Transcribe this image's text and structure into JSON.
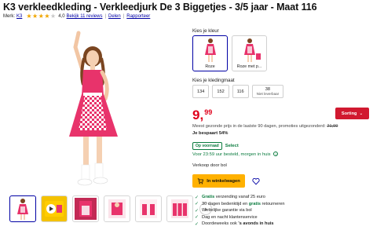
{
  "product": {
    "title": "K3 verkleedkleding - Verkleedjurk De 3 Biggetjes - 3/5 jaar - Maat 116",
    "brand_prefix": "Merk:",
    "brand": "K3",
    "rating": 4.0,
    "rating_text": "4,0",
    "reviews_link": "Bekijk 11 reviews",
    "share": "Delen",
    "report": "Rapporteer"
  },
  "thumbnails": [
    "thumb-dress-front",
    "thumb-video",
    "thumb-detail",
    "thumb-pack-1",
    "thumb-pack-2",
    "thumb-pack-3"
  ],
  "color_selector": {
    "label": "Kies je kleur",
    "options": [
      {
        "label": "Roze",
        "selected": true
      },
      {
        "label": "Roze met p...",
        "selected": false
      }
    ]
  },
  "size_selector": {
    "label": "Kies je kledingmaat",
    "options": [
      {
        "label": "134",
        "sub": ""
      },
      {
        "label": "152",
        "sub": ""
      },
      {
        "label": "116",
        "sub": ""
      },
      {
        "label": "38",
        "sub": "Niet leverbaar"
      }
    ]
  },
  "pricing": {
    "price_whole": "9,",
    "price_cents": "99",
    "sort_button": "Sorting",
    "prev_price_text": "Meest gezonde prijs in de laatste 90 dagen, promoties uitgezonderd:",
    "prev_price": "21,99",
    "savings": "Je bespaart 54%"
  },
  "availability": {
    "stock_badge": "Op voorraad",
    "select": "Select",
    "delivery": "Voor 23:59 uur besteld, morgen in huis",
    "seller": "Verkoop door bol"
  },
  "actions": {
    "cart_button": "In winkelwagen"
  },
  "usps": [
    {
      "pre": "",
      "highlight": "Gratis",
      "post": " verzending vanaf 25 euro"
    },
    {
      "pre": "30 dagen bedenktijd en ",
      "highlight": "gratis",
      "post": " retourneren"
    },
    {
      "pre": "Wettelijke garantie via bol",
      "highlight": "",
      "post": ""
    },
    {
      "pre": "Dag en nacht klantenservice",
      "highlight": "",
      "post": ""
    },
    {
      "pre": "Doordeweeks ook ",
      "highlight": "",
      "post": "'s avonds in huis",
      "bold_post": "'s avonds"
    }
  ],
  "colors": {
    "accent_blue": "#0000a4",
    "price_red": "#e0001b",
    "cart_yellow": "#ffb100",
    "stock_green": "#0a7b3e",
    "dress_pink": "#e8336b"
  }
}
